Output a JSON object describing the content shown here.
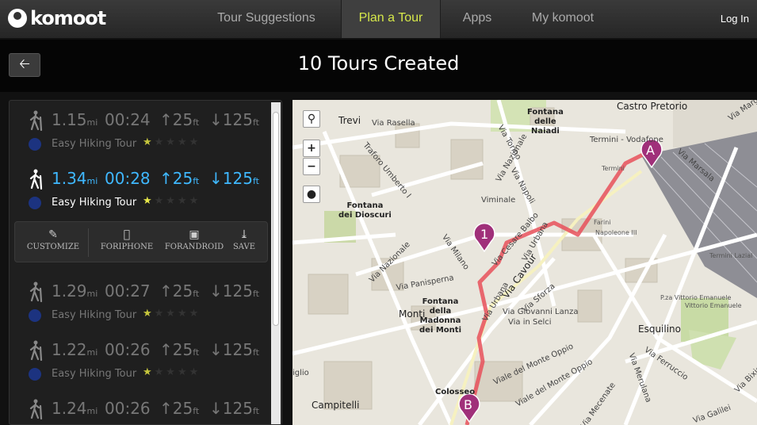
{
  "brand": {
    "name": "komoot"
  },
  "nav": {
    "items": [
      "Tour Suggestions",
      "Plan a Tour",
      "Apps",
      "My komoot"
    ],
    "active": "Plan a Tour",
    "login": "Log In"
  },
  "header": {
    "back_icon": "left-arrow-icon",
    "title": "10 Tours Created"
  },
  "tours": [
    {
      "distance": "1.15",
      "dist_unit": "mi",
      "time": "00:24",
      "up": "25",
      "down": "125",
      "elev_unit": "ft",
      "difficulty": "Easy Hiking Tour",
      "rating": 1,
      "selected": false
    },
    {
      "distance": "1.34",
      "dist_unit": "mi",
      "time": "00:28",
      "up": "25",
      "down": "125",
      "elev_unit": "ft",
      "difficulty": "Easy Hiking Tour",
      "rating": 1,
      "selected": true
    },
    {
      "distance": "1.29",
      "dist_unit": "mi",
      "time": "00:27",
      "up": "25",
      "down": "125",
      "elev_unit": "ft",
      "difficulty": "Easy Hiking Tour",
      "rating": 1,
      "selected": false
    },
    {
      "distance": "1.22",
      "dist_unit": "mi",
      "time": "00:26",
      "up": "25",
      "down": "125",
      "elev_unit": "ft",
      "difficulty": "Easy Hiking Tour",
      "rating": 1,
      "selected": false
    },
    {
      "distance": "1.24",
      "dist_unit": "mi",
      "time": "00:26",
      "up": "25",
      "down": "125",
      "elev_unit": "ft",
      "difficulty": "Easy Hiking Tour",
      "rating": 1,
      "selected": false
    }
  ],
  "tour_actions": [
    {
      "label": "CUSTOMIZE",
      "icon": "edit-icon"
    },
    {
      "label": "FORIPHONE",
      "icon": "apple-icon"
    },
    {
      "label": "FORANDROID",
      "icon": "android-icon"
    },
    {
      "label": "SAVE",
      "icon": "download-icon"
    }
  ],
  "map": {
    "controls": {
      "search": "search-icon",
      "zoom_in": "+",
      "zoom_out": "−",
      "locate": "locate-icon"
    },
    "markers": {
      "start": "A",
      "end": "B",
      "waypoint": "1"
    },
    "route_color": "#e8505b",
    "marker_color": "#a0307a",
    "labels": {
      "castro_pretorio": "Castro Pretorio",
      "trevi": "Trevi",
      "via_rasella": "Via Rasella",
      "fontana_naiadi_1": "Fontana",
      "fontana_naiadi_2": "delle",
      "fontana_naiadi_3": "Naiadi",
      "termini_vodafone": "Termini - Vodafone",
      "termini": "Termini",
      "via_marsala": "Via Marsala",
      "via_marghera": "Via Marghe",
      "viminale": "Viminale",
      "via_nazionale": "Via Nazionale",
      "via_torino": "Via Torino",
      "via_napoli": "Via Napoli",
      "traforo": "Traforo Umberto I",
      "fontana_dioscuri_1": "Fontana",
      "fontana_dioscuri_2": "dei Dioscuri",
      "via_milano": "Via Milano",
      "via_cesare_balbo": "Via Cesare Balbo",
      "via_urbana": "Via Urbana",
      "via_cavour": "Via Cavour",
      "farini": "Farini",
      "napoleone": "Napoleone III",
      "termini_lazio": "Termini Lazial",
      "via_nazionale_2": "Via Nazionale",
      "via_panisperna": "Via Panisperna",
      "via_sforza": "Via Sforza",
      "monti": "Monti",
      "fontana_madonna_1": "Fontana",
      "fontana_madonna_2": "della",
      "fontana_madonna_3": "Madonna",
      "fontana_madonna_4": "dei Monti",
      "via_giovanni_lanza": "Via Giovanni Lanza",
      "via_in_selci": "Via in Selci",
      "piazza_vittorio_1": "P.za Vittorio Emanuele",
      "piazza_vittorio_2": "Vittorio Emanuele",
      "esquilino": "Esquilino",
      "via_ferruccio": "Via Ferruccio",
      "via_merulana": "Via Merulana",
      "via_mecenate": "Via Mecenate",
      "viale_del_monte_oppio": "Viale del Monte Oppio",
      "colosseo": "Colosseo",
      "campitelli": "Campitelli",
      "viale_monte": "Viale del Monte Oppio",
      "via_bixio": "Via Bixio",
      "via_galilei": "Via Galilei",
      "iglio": "iglio"
    }
  }
}
